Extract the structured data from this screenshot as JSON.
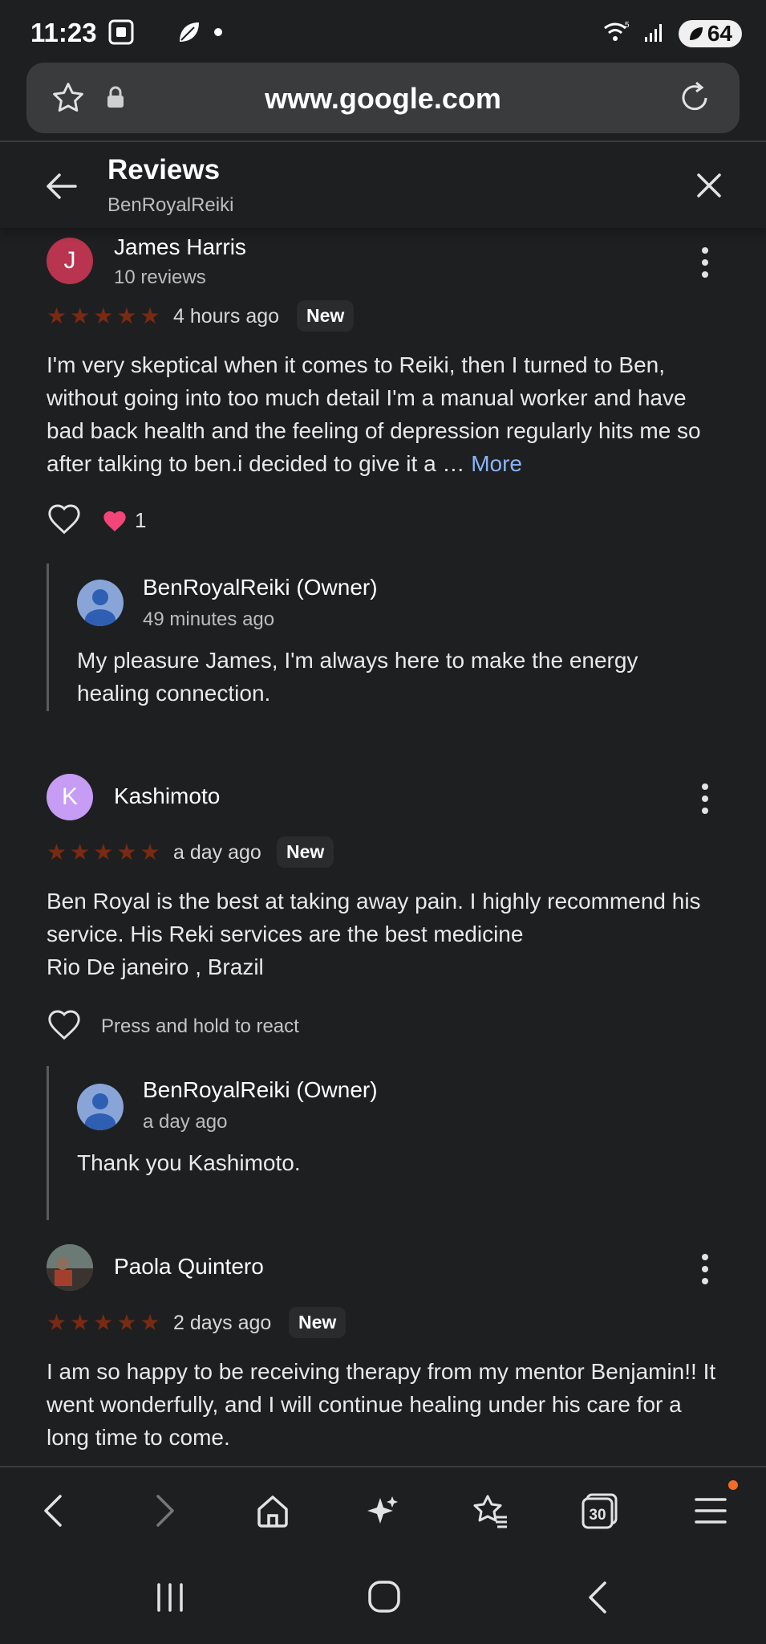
{
  "status_bar": {
    "time": "11:23",
    "battery": "64",
    "wifi_label": "5"
  },
  "browser": {
    "url": "www.google.com",
    "tab_count": "30"
  },
  "header": {
    "title": "Reviews",
    "subtitle": "BenRoyalReiki"
  },
  "reviews": [
    {
      "avatar_letter": "J",
      "avatar_color": "#b8344f",
      "name": "James Harris",
      "review_count": "10 reviews",
      "time": "4 hours ago",
      "badge": "New",
      "text": "I'm very skeptical when it comes to Reiki, then I turned to Ben, without going into too much detail I'm a manual worker and have bad back health and the feeling of depression regularly hits me so after talking to ben.i decided to give it a …",
      "more_label": "More",
      "reaction_count": "1",
      "reply": {
        "owner": "BenRoyalReiki (Owner)",
        "time": "49 minutes ago",
        "text": "My pleasure James, I'm always here to make the energy healing connection."
      }
    },
    {
      "avatar_letter": "K",
      "avatar_color": "#c69cf4",
      "name": "Kashimoto",
      "time": "a day ago",
      "badge": "New",
      "text": "Ben Royal is the best at taking away pain. I highly recommend his service. His Reki services are the best medicine\nRio De janeiro , Brazil",
      "react_hint": "Press and hold to react",
      "reply": {
        "owner": "BenRoyalReiki (Owner)",
        "time": "a day ago",
        "text": "Thank you Kashimoto."
      }
    },
    {
      "name": "Paola Quintero",
      "time": "2 days ago",
      "badge": "New",
      "text": "I am so happy to be receiving therapy from my mentor Benjamin!! It went wonderfully, and I will continue healing under his care for a long time to come."
    }
  ],
  "icons": {
    "star_color": "#7a2a12",
    "accent_link": "#8ab4f8",
    "notification_dot": "#f26c23"
  }
}
